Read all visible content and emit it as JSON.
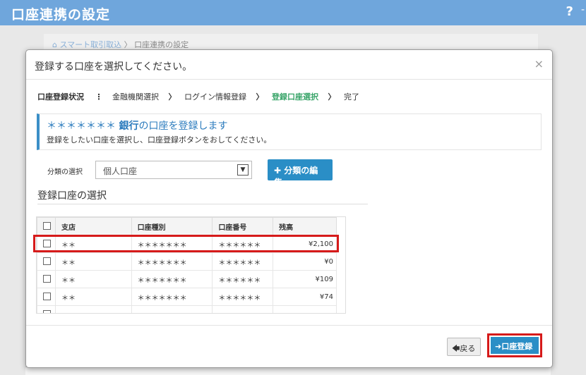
{
  "topbar": {
    "title": "口座連携の設定",
    "help": "?",
    "help2": "-"
  },
  "bg": {
    "crumb_home": "スマート取引取込",
    "crumb_sep": "〉",
    "crumb_current": "口座連携の設定"
  },
  "modal": {
    "title": "登録する口座を選択してください。",
    "close": "×",
    "steps": {
      "status_label": "口座登録状況",
      "dots": "⋮",
      "step1": "金融機関選択",
      "step2": "ログイン情報登録",
      "step3": "登録口座選択",
      "step4": "完了",
      "arrow": "〉"
    },
    "notice": {
      "prefix": "＊＊＊＊＊＊＊",
      "bank": "銀行",
      "heading_rest": "の口座を登録します",
      "sub": "登録をしたい口座を選択し、口座登録ボタンをおしてください。"
    },
    "category": {
      "label": "分類の選択",
      "value": "個人口座",
      "edit_button": "✚ 分類の編集"
    },
    "section_title": "登録口座の選択",
    "table": {
      "headers": [
        "支店",
        "口座種別",
        "口座番号",
        "残高"
      ],
      "rows": [
        {
          "branch": "＊＊",
          "type": "＊＊＊＊＊＊＊",
          "number": "＊＊＊＊＊＊",
          "balance": "¥2,100"
        },
        {
          "branch": "＊＊",
          "type": "＊＊＊＊＊＊＊",
          "number": "＊＊＊＊＊＊",
          "balance": "¥0"
        },
        {
          "branch": "＊＊",
          "type": "＊＊＊＊＊＊＊",
          "number": "＊＊＊＊＊＊",
          "balance": "¥109"
        },
        {
          "branch": "＊＊",
          "type": "＊＊＊＊＊＊＊",
          "number": "＊＊＊＊＊＊",
          "balance": "¥74"
        }
      ]
    },
    "footer": {
      "back": "🡄戻る",
      "register": "➜口座登録"
    }
  }
}
